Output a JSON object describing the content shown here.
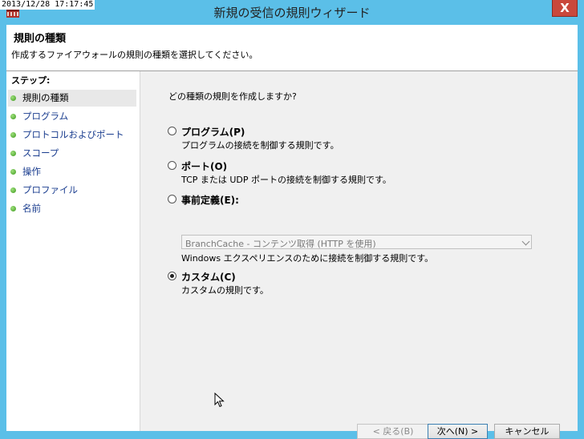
{
  "timestamp": "2013/12/28 17:17:45",
  "window": {
    "title": "新規の受信の規則ウィザード",
    "close_glyph": "X"
  },
  "header": {
    "title": "規則の種類",
    "subtitle": "作成するファイアウォールの規則の種類を選択してください。"
  },
  "sidebar": {
    "steps_label": "ステップ:",
    "items": [
      {
        "label": "規則の種類",
        "current": true
      },
      {
        "label": "プログラム"
      },
      {
        "label": "プロトコルおよびポート"
      },
      {
        "label": "スコープ"
      },
      {
        "label": "操作"
      },
      {
        "label": "プロファイル"
      },
      {
        "label": "名前"
      }
    ]
  },
  "main": {
    "question": "どの種類の規則を作成しますか?",
    "options": [
      {
        "label": "プログラム(P)",
        "desc": "プログラムの接続を制御する規則です。",
        "checked": false
      },
      {
        "label": "ポート(O)",
        "desc": "TCP または UDP ポートの接続を制御する規則です。",
        "checked": false
      },
      {
        "label": "事前定義(E):",
        "desc": "Windows エクスペリエンスのために接続を制御する規則です。",
        "checked": false
      },
      {
        "label": "カスタム(C)",
        "desc": "カスタムの規則です。",
        "checked": true
      }
    ],
    "predefined_dropdown": {
      "value": "BranchCache - コンテンツ取得 (HTTP を使用)"
    }
  },
  "buttons": {
    "back": "< 戻る(B)",
    "next": "次へ(N) >",
    "cancel": "キャンセル"
  },
  "colors": {
    "frame": "#5bbfe8",
    "close": "#c9483c",
    "link": "#1a3d8f"
  },
  "icons": {
    "app": "firewall-brick-icon",
    "cursor": "mouse-pointer-icon"
  }
}
